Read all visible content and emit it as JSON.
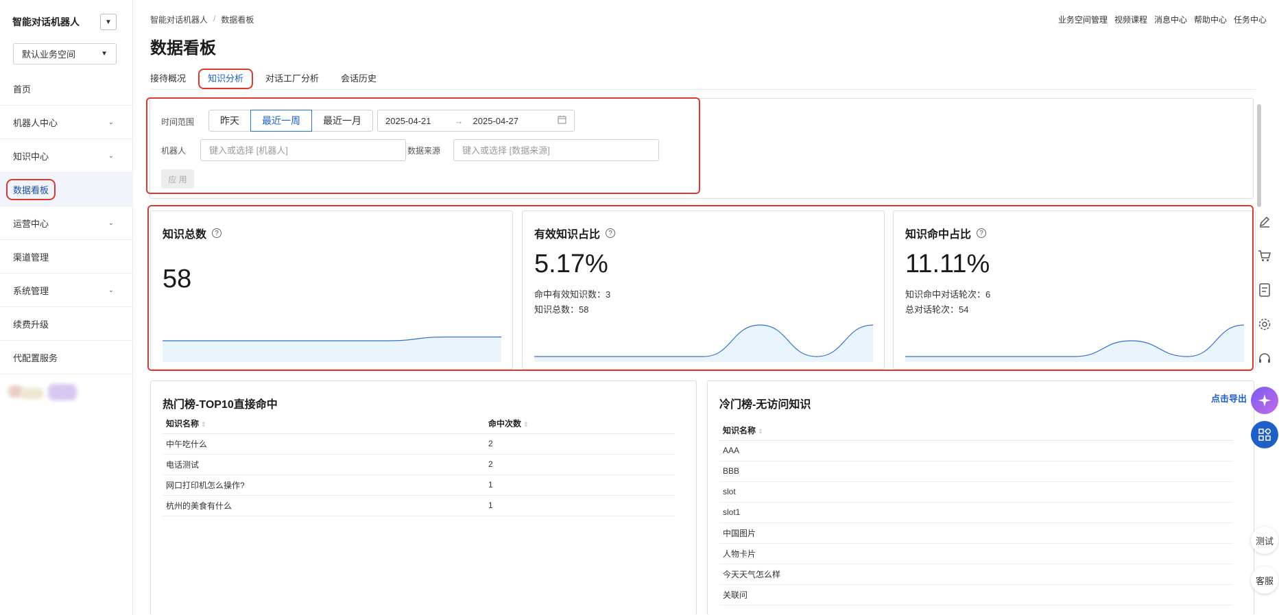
{
  "app": {
    "title": "智能对话机器人",
    "workspace": "默认业务空间"
  },
  "sidebar": {
    "items": [
      {
        "label": "首页"
      },
      {
        "label": "机器人中心"
      },
      {
        "label": "知识中心"
      },
      {
        "label": "数据看板"
      },
      {
        "label": "运营中心"
      },
      {
        "label": "渠道管理"
      },
      {
        "label": "系统管理"
      },
      {
        "label": "续费升级"
      },
      {
        "label": "代配置服务"
      }
    ]
  },
  "breadcrumb": {
    "root": "智能对话机器人",
    "separator": "/",
    "current": "数据看板"
  },
  "top_links": {
    "workspace_mgmt": "业务空间管理",
    "video_course": "视频课程",
    "messages": "消息中心",
    "help": "帮助中心",
    "tasks": "任务中心"
  },
  "page": {
    "title": "数据看板"
  },
  "tabs": [
    {
      "label": "接待概况"
    },
    {
      "label": "知识分析",
      "active": true
    },
    {
      "label": "对话工厂分析"
    },
    {
      "label": "会话历史"
    }
  ],
  "filters": {
    "time_label": "时间范围",
    "time_options": [
      "昨天",
      "最近一周",
      "最近一月"
    ],
    "time_selected": "最近一周",
    "date_start": "2025-04-21",
    "date_arrow": "→",
    "date_end": "2025-04-27",
    "robot_label": "机器人",
    "robot_placeholder": "键入或选择 [机器人]",
    "source_label": "数据来源",
    "source_placeholder": "键入或选择 [数据来源]",
    "apply": "应 用"
  },
  "stats": {
    "total": {
      "title": "知识总数",
      "value": "58",
      "spark": [
        0.5,
        0.5,
        0.5,
        0.5,
        0.5,
        0.62,
        0.62
      ]
    },
    "effective": {
      "title": "有效知识占比",
      "value": "5.17%",
      "line1_label": "命中有效知识数：",
      "line1_value": "3",
      "line2_label": "知识总数：",
      "line2_value": "58",
      "spark": [
        0,
        0,
        0,
        0,
        1,
        0,
        1
      ]
    },
    "hit": {
      "title": "知识命中占比",
      "value": "11.11%",
      "line1_label": "知识命中对话轮次：",
      "line1_value": "6",
      "line2_label": "总对话轮次：",
      "line2_value": "54",
      "spark": [
        0,
        0,
        0,
        0,
        0.5,
        0,
        1
      ]
    }
  },
  "hot": {
    "title": "热门榜-TOP10直接命中",
    "columns": [
      "知识名称",
      "命中次数"
    ],
    "rows": [
      {
        "name": "中午吃什么",
        "count": "2"
      },
      {
        "name": "电话测试",
        "count": "2"
      },
      {
        "name": "网口打印机怎么操作?",
        "count": "1"
      },
      {
        "name": "杭州的美食有什么",
        "count": "1"
      }
    ]
  },
  "cold": {
    "title": "冷门榜-无访问知识",
    "export": "点击导出",
    "column": "知识名称",
    "rows": [
      "AAA",
      "BBB",
      "slot",
      "slot1",
      "中国图片",
      "人物卡片",
      "今天天气怎么样",
      "关联问"
    ]
  },
  "float": {
    "test": "测试",
    "service": "客服"
  },
  "colors": {
    "accent": "#1c5fc9",
    "highlight": "#d9392e",
    "spark_line": "#2f6fd0",
    "spark_fill": "#eaf4fd"
  }
}
